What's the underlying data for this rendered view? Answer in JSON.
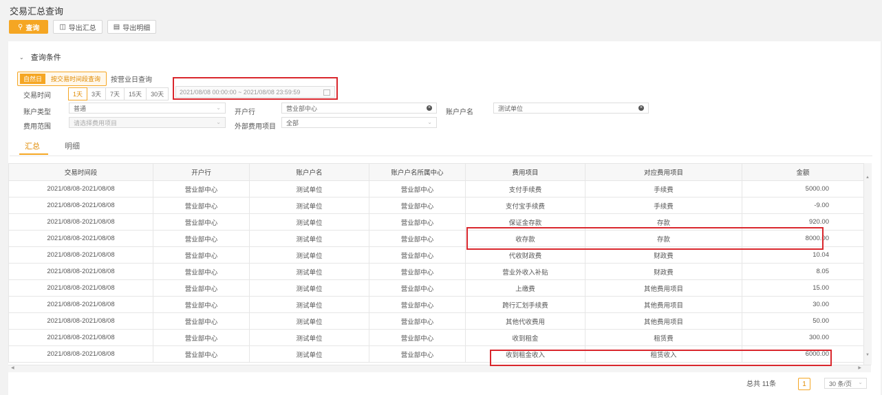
{
  "page_title": "交易汇总查询",
  "toolbar": {
    "query": "查询",
    "export_summary": "导出汇总",
    "export_detail": "导出明细"
  },
  "filter": {
    "header": "查询条件",
    "mode_tabs": [
      "自然日",
      "按交易时间段查询"
    ],
    "mode_link": "按营业日查询",
    "time_label": "交易时间",
    "time_options": [
      "1天",
      "3天",
      "7天",
      "15天",
      "30天"
    ],
    "date_range": "2021/08/08 00:00:00  ~  2021/08/08 23:59:59",
    "account_type_label": "账户类型",
    "account_type_value": "普通",
    "branch_label": "开户行",
    "branch_value": "营业部中心",
    "holder_label": "账户户名",
    "holder_value": "测试单位",
    "fee_range_label": "费用范围",
    "fee_range_placeholder": "请选择费用项目",
    "external_label": "外部费用项目",
    "external_value": "全部"
  },
  "view_tabs": [
    "汇总",
    "明细"
  ],
  "table": {
    "columns": [
      "交易时间段",
      "开户行",
      "账户户名",
      "账户户名所属中心",
      "费用项目",
      "对应费用项目",
      "金额"
    ],
    "rows": [
      [
        "2021/08/08-2021/08/08",
        "营业部中心",
        "测试单位",
        "营业部中心",
        "支付手续费",
        "手续费",
        "5000.00"
      ],
      [
        "2021/08/08-2021/08/08",
        "营业部中心",
        "测试单位",
        "营业部中心",
        "支付宝手续费",
        "手续费",
        "-9.00"
      ],
      [
        "2021/08/08-2021/08/08",
        "营业部中心",
        "测试单位",
        "营业部中心",
        "保证金存款",
        "存款",
        "920.00"
      ],
      [
        "2021/08/08-2021/08/08",
        "营业部中心",
        "测试单位",
        "营业部中心",
        "收存款",
        "存款",
        "8000.00"
      ],
      [
        "2021/08/08-2021/08/08",
        "营业部中心",
        "测试单位",
        "营业部中心",
        "代收财政费",
        "财政费",
        "10.04"
      ],
      [
        "2021/08/08-2021/08/08",
        "营业部中心",
        "测试单位",
        "营业部中心",
        "营业外收入补贴",
        "财政费",
        "8.05"
      ],
      [
        "2021/08/08-2021/08/08",
        "营业部中心",
        "测试单位",
        "营业部中心",
        "上缴费",
        "其他费用项目",
        "15.00"
      ],
      [
        "2021/08/08-2021/08/08",
        "营业部中心",
        "测试单位",
        "营业部中心",
        "跨行汇划手续费",
        "其他费用项目",
        "30.00"
      ],
      [
        "2021/08/08-2021/08/08",
        "营业部中心",
        "测试单位",
        "营业部中心",
        "其他代收费用",
        "其他费用项目",
        "50.00"
      ],
      [
        "2021/08/08-2021/08/08",
        "营业部中心",
        "测试单位",
        "营业部中心",
        "收到租金",
        "租赁费",
        "300.00"
      ],
      [
        "2021/08/08-2021/08/08",
        "营业部中心",
        "测试单位",
        "营业部中心",
        "收到租金收入",
        "租赁收入",
        "6000.00"
      ]
    ]
  },
  "pager": {
    "total": "总共  11条",
    "page": "1",
    "page_size": "30 条/页"
  },
  "colors": {
    "accent": "#f5a623",
    "highlight": "#d9262c"
  }
}
